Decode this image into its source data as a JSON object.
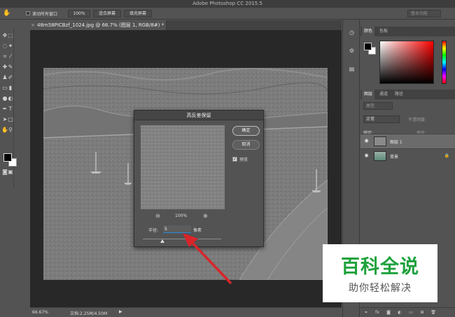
{
  "app": {
    "title": "Adobe Photoshop CC 2015.5"
  },
  "options_bar": {
    "scroll_all_label": "滚动所有窗口",
    "zoom_100": "100%",
    "fit_screen": "适合屏幕",
    "fill_screen": "填充屏幕",
    "workspace": "基本功能"
  },
  "document": {
    "tab_title": "48m58PICBzf_1024.jpg @ 66.7% (图层 1, RGB/8#) *"
  },
  "status": {
    "zoom": "66.67%",
    "doc_size": "文档:2.25M/4.50M"
  },
  "dialog": {
    "title": "高反差保留",
    "ok": "确定",
    "cancel": "取消",
    "preview_label": "预览",
    "preview_checked": true,
    "zoom": "100%",
    "radius_label": "半径:",
    "radius_value": "5",
    "radius_unit": "像素"
  },
  "panels": {
    "color_tabs": [
      "颜色",
      "色板"
    ],
    "layer_tabs": [
      "图层",
      "通道",
      "路径"
    ],
    "search_placeholder": "类型",
    "blend_mode": "正常",
    "opacity_label": "不透明度:",
    "lock_label": "锁定:",
    "fill_label": "填充:",
    "layers": [
      {
        "name": "图层 1",
        "selected": true,
        "locked": false
      },
      {
        "name": "背景",
        "selected": false,
        "locked": true
      }
    ]
  },
  "watermark": {
    "main": "百科全说",
    "sub": "助你轻松解决"
  },
  "colors": {
    "accent": "#2a86d8",
    "watermark_green": "#1ea13c",
    "arrow_red": "#d8252a"
  }
}
